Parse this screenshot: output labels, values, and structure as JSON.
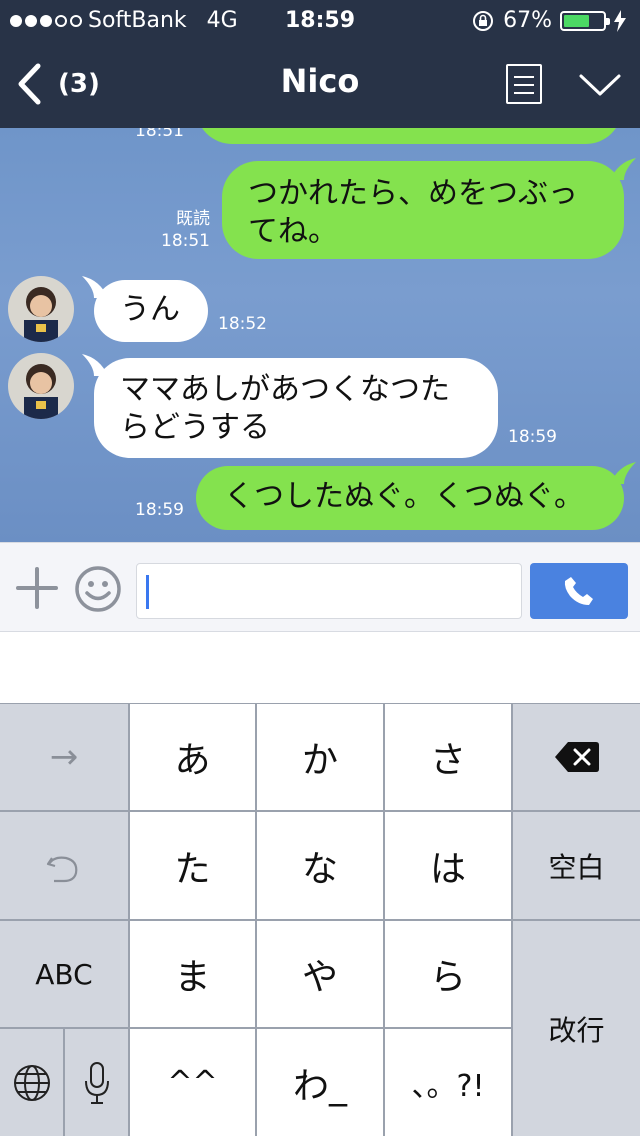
{
  "status_bar": {
    "carrier": "SoftBank",
    "network": "4G",
    "time": "18:59",
    "battery_percent": "67%",
    "battery_level": 0.67
  },
  "header": {
    "unread_count": "(3)",
    "title": "Nico"
  },
  "messages": [
    {
      "side": "right",
      "text_lines": [
        "つかれたら、めをつぶっ",
        "てね。"
      ],
      "read": "既読",
      "time": "18:51"
    },
    {
      "side": "left",
      "text_lines": [
        "うん"
      ],
      "time": "18:52"
    },
    {
      "side": "left",
      "text_lines": [
        "ママあしがあつくなつた",
        "らどうする"
      ],
      "time": "18:59"
    },
    {
      "side": "right",
      "text_lines": [
        "くつしたぬぐ。くつぬぐ。"
      ],
      "time": "18:59"
    }
  ],
  "partial_time": "18:51",
  "input": {
    "value": "",
    "placeholder": ""
  },
  "keyboard": {
    "arrow": "→",
    "undo": "↶",
    "abc": "ABC",
    "space": "空白",
    "enter": "改行",
    "rows": [
      [
        "あ",
        "か",
        "さ"
      ],
      [
        "た",
        "な",
        "は"
      ],
      [
        "ま",
        "や",
        "ら"
      ],
      [
        "^^",
        "わ_",
        "、。?!"
      ]
    ]
  },
  "colors": {
    "header_bg": "#283347",
    "my_bubble": "#84e24e",
    "their_bubble": "#ffffff",
    "call_button": "#4a82e0"
  }
}
